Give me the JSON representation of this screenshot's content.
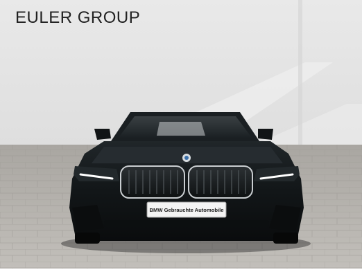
{
  "overlay": {
    "brand_text": "EULER GROUP"
  },
  "photo": {
    "subject": "car-front",
    "license_plate_text": "BMW Gebrauchte Automobile",
    "colors": {
      "wall": "#e6e6e6",
      "floor": "#b8b5b0",
      "car_body": "#15191c",
      "plate": "#f4f4f4"
    }
  }
}
